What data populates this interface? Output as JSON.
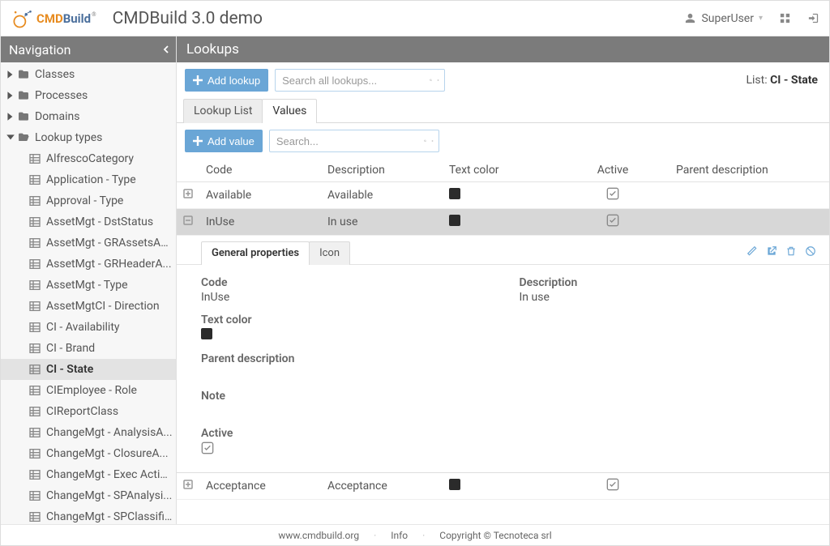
{
  "header": {
    "app_title": "CMDBuild 3.0 demo",
    "logo": {
      "text_left": "CMD",
      "text_right": "Build"
    },
    "user": "SuperUser"
  },
  "sidebar": {
    "title": "Navigation",
    "top": [
      {
        "label": "Classes",
        "expanded": false
      },
      {
        "label": "Processes",
        "expanded": false
      },
      {
        "label": "Domains",
        "expanded": false
      },
      {
        "label": "Lookup types",
        "expanded": true
      }
    ],
    "lookup_types": [
      "AlfrescoCategory",
      "Application - Type",
      "Approval - Type",
      "AssetMgt - DstStatus",
      "AssetMgt - GRAssetsAc...",
      "AssetMgt - GRHeaderA...",
      "AssetMgt - Type",
      "AssetMgtCI - Direction",
      "CI - Availability",
      "CI - Brand",
      "CI - State",
      "CIEmployee - Role",
      "CIReportClass",
      "ChangeMgt - AnalysisA...",
      "ChangeMgt - ClosureA...",
      "ChangeMgt - Exec Action",
      "ChangeMgt - SPAnalysi...",
      "ChangeMgt - SPClassifi..."
    ],
    "selected": "CI - State"
  },
  "content": {
    "title": "Lookups",
    "add_lookup_label": "Add lookup",
    "search_placeholder": "Search all lookups...",
    "list_prefix": "List: ",
    "list_name": "CI - State",
    "tabs": [
      {
        "label": "Lookup List",
        "active": false
      },
      {
        "label": "Values",
        "active": true
      }
    ],
    "add_value_label": "Add value",
    "search2_placeholder": "Search...",
    "columns": {
      "code": "Code",
      "description": "Description",
      "text_color": "Text color",
      "active": "Active",
      "parent": "Parent description"
    },
    "rows": [
      {
        "code": "Available",
        "description": "Available",
        "color": "#2b2b2b",
        "active": true,
        "expanded": false
      },
      {
        "code": "InUse",
        "description": "In use",
        "color": "#2b2b2b",
        "active": true,
        "expanded": true
      },
      {
        "code": "Acceptance",
        "description": "Acceptance",
        "color": "#2b2b2b",
        "active": true,
        "expanded": false
      }
    ],
    "detail": {
      "tabs": [
        {
          "label": "General properties",
          "active": true
        },
        {
          "label": "Icon",
          "active": false
        }
      ],
      "fields": {
        "code_label": "Code",
        "code_value": "InUse",
        "description_label": "Description",
        "description_value": "In use",
        "text_color_label": "Text color",
        "parent_label": "Parent description",
        "note_label": "Note",
        "active_label": "Active"
      }
    }
  },
  "footer": {
    "url": "www.cmdbuild.org",
    "info": "Info",
    "copyright": "Copyright © Tecnoteca srl"
  }
}
